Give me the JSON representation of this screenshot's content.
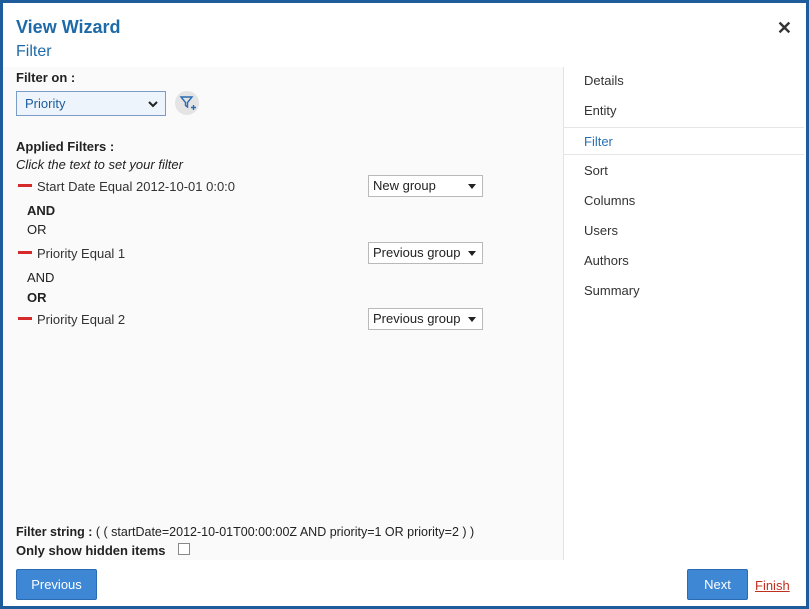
{
  "header": {
    "title": "View Wizard",
    "subtitle": "Filter",
    "close_label": "✕"
  },
  "filter_on": {
    "label": "Filter on :",
    "selected": "Priority"
  },
  "applied": {
    "heading": "Applied Filters :",
    "hint": "Click the text to set your filter",
    "filters": [
      {
        "text": "Start Date Equal 2012-10-01 0:0:0",
        "group": "New group"
      },
      {
        "text": "Priority Equal 1",
        "group": "Previous group"
      },
      {
        "text": "Priority Equal 2",
        "group": "Previous group"
      }
    ],
    "operators": [
      {
        "and": "AND",
        "or": "OR",
        "active": "and"
      },
      {
        "and": "AND",
        "or": "OR",
        "active": "or"
      }
    ]
  },
  "filter_string": {
    "label": "Filter string :",
    "value": "( ( startDate=2012-10-01T00:00:00Z AND priority=1 OR priority=2 ) )"
  },
  "hidden_items": {
    "label": "Only show hidden items",
    "checked": false
  },
  "sidebar": {
    "items": [
      {
        "label": "Details"
      },
      {
        "label": "Entity"
      },
      {
        "label": "Filter"
      },
      {
        "label": "Sort"
      },
      {
        "label": "Columns"
      },
      {
        "label": "Users"
      },
      {
        "label": "Authors"
      },
      {
        "label": "Summary"
      }
    ],
    "active": "Filter"
  },
  "footer": {
    "previous": "Previous",
    "next": "Next",
    "finish": "Finish"
  },
  "colors": {
    "accent": "#1e6aa8",
    "button": "#3d87d4",
    "remove": "#d42a2a",
    "finish": "#c0301f"
  }
}
